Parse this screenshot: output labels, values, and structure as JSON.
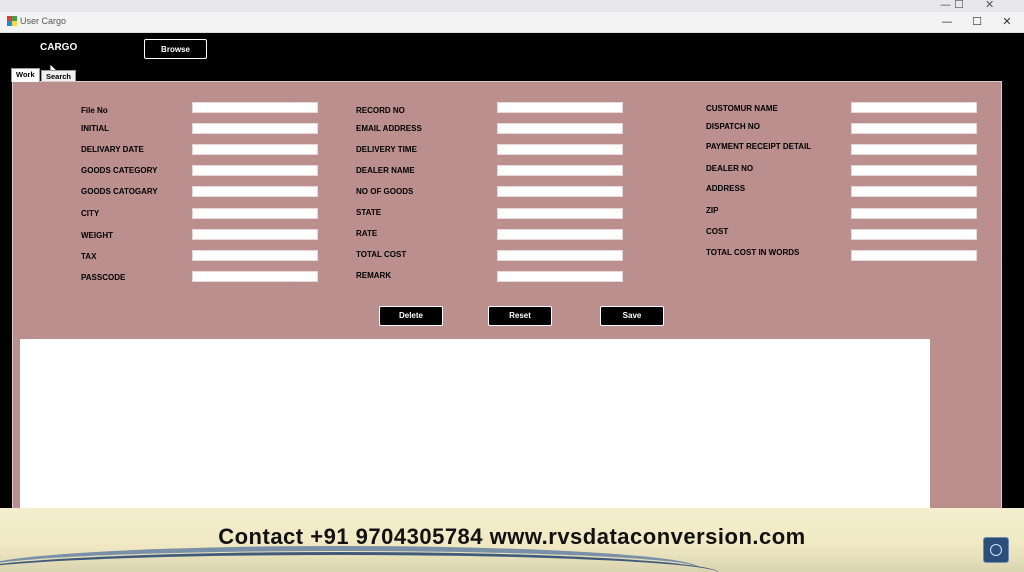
{
  "window": {
    "title": "User Cargo",
    "minimize_glyph": "—",
    "maximize_glyph": "☐",
    "close_glyph": "✕",
    "icon": "app-icon"
  },
  "header": {
    "cargo_label": "CARGO",
    "browse_label": "Browse"
  },
  "tabs": [
    {
      "label": "Work"
    },
    {
      "label": "Search"
    }
  ],
  "form": {
    "col1": [
      {
        "label": "File No",
        "value": ""
      },
      {
        "label": "INITIAL",
        "value": ""
      },
      {
        "label": "DELIVARY DATE",
        "value": ""
      },
      {
        "label": "GOODS CATEGORY",
        "value": ""
      },
      {
        "label": "GOODS CATOGARY",
        "value": ""
      },
      {
        "label": "CITY",
        "value": ""
      },
      {
        "label": "WEIGHT",
        "value": ""
      },
      {
        "label": "TAX",
        "value": ""
      },
      {
        "label": "PASSCODE",
        "value": ""
      }
    ],
    "col2": [
      {
        "label": "RECORD NO",
        "value": ""
      },
      {
        "label": "EMAIL ADDRESS",
        "value": ""
      },
      {
        "label": "DELIVERY TIME",
        "value": ""
      },
      {
        "label": "DEALER NAME",
        "value": ""
      },
      {
        "label": "NO OF GOODS",
        "value": ""
      },
      {
        "label": "STATE",
        "value": ""
      },
      {
        "label": "RATE",
        "value": ""
      },
      {
        "label": "TOTAL COST",
        "value": ""
      },
      {
        "label": "REMARK",
        "value": ""
      }
    ],
    "col3": [
      {
        "label": "CUSTOMUR NAME",
        "value": ""
      },
      {
        "label": "DISPATCH NO",
        "value": ""
      },
      {
        "label": "PAYMENT RECEIPT DETAIL",
        "value": ""
      },
      {
        "label": "DEALER NO",
        "value": ""
      },
      {
        "label": "ADDRESS",
        "value": ""
      },
      {
        "label": "ZIP",
        "value": ""
      },
      {
        "label": "COST",
        "value": ""
      },
      {
        "label": "TOTAL COST IN WORDS",
        "value": ""
      }
    ]
  },
  "actions": {
    "delete_label": "Delete",
    "reset_label": "Reset",
    "save_label": "Save"
  },
  "banner": {
    "text": "Contact +91 9704305784 www.rvsdataconversion.com"
  },
  "colors": {
    "panel": "#bc8f8f",
    "client": "#000000",
    "banner": "#f4efce"
  }
}
